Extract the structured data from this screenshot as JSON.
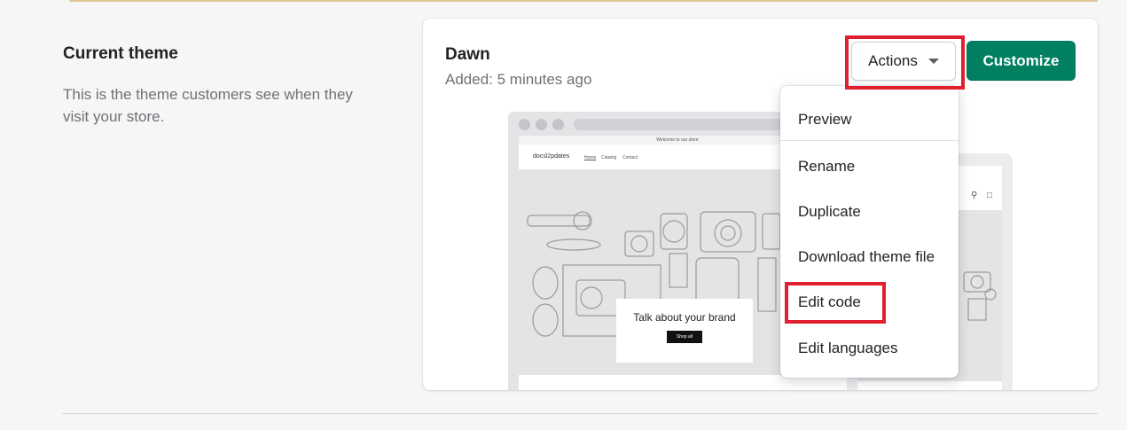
{
  "section": {
    "title": "Current theme",
    "description": "This is the theme customers see when they visit your store."
  },
  "theme": {
    "name": "Dawn",
    "added": "Added: 5 minutes ago"
  },
  "buttons": {
    "actions": "Actions",
    "customize": "Customize"
  },
  "colors": {
    "primary": "#008060",
    "highlight": "#e0202e"
  },
  "preview": {
    "announcement": "Welcome to our store",
    "store_name": "docsl2pdates",
    "nav": [
      "Home",
      "Catalog",
      "Contact"
    ],
    "brand_heading": "Talk about your brand",
    "shop_button": "Shop all"
  },
  "menu": {
    "items": [
      "Preview",
      "Rename",
      "Duplicate",
      "Download theme file",
      "Edit code",
      "Edit languages"
    ]
  }
}
